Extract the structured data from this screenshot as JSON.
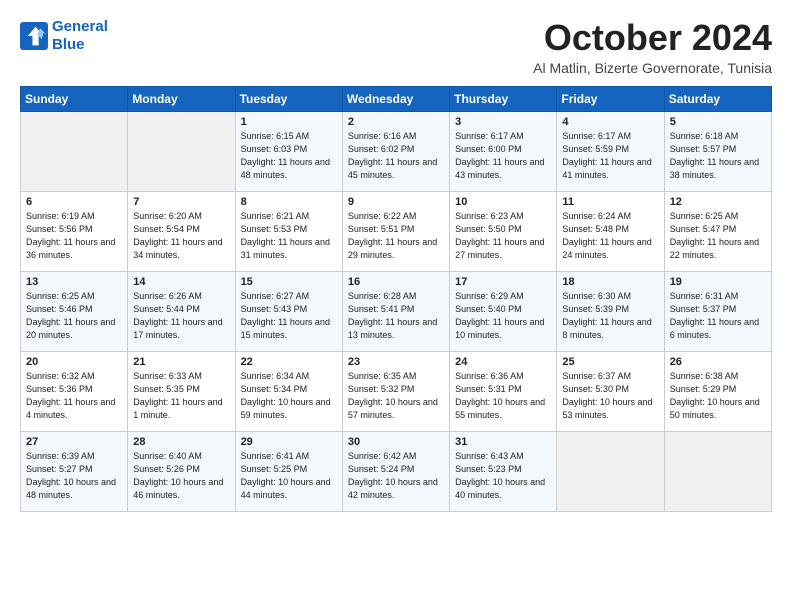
{
  "logo": {
    "line1": "General",
    "line2": "Blue"
  },
  "title": "October 2024",
  "location": "Al Matlin, Bizerte Governorate, Tunisia",
  "weekdays": [
    "Sunday",
    "Monday",
    "Tuesday",
    "Wednesday",
    "Thursday",
    "Friday",
    "Saturday"
  ],
  "weeks": [
    [
      {
        "day": "",
        "info": ""
      },
      {
        "day": "",
        "info": ""
      },
      {
        "day": "1",
        "info": "Sunrise: 6:15 AM\nSunset: 6:03 PM\nDaylight: 11 hours and 48 minutes."
      },
      {
        "day": "2",
        "info": "Sunrise: 6:16 AM\nSunset: 6:02 PM\nDaylight: 11 hours and 45 minutes."
      },
      {
        "day": "3",
        "info": "Sunrise: 6:17 AM\nSunset: 6:00 PM\nDaylight: 11 hours and 43 minutes."
      },
      {
        "day": "4",
        "info": "Sunrise: 6:17 AM\nSunset: 5:59 PM\nDaylight: 11 hours and 41 minutes."
      },
      {
        "day": "5",
        "info": "Sunrise: 6:18 AM\nSunset: 5:57 PM\nDaylight: 11 hours and 38 minutes."
      }
    ],
    [
      {
        "day": "6",
        "info": "Sunrise: 6:19 AM\nSunset: 5:56 PM\nDaylight: 11 hours and 36 minutes."
      },
      {
        "day": "7",
        "info": "Sunrise: 6:20 AM\nSunset: 5:54 PM\nDaylight: 11 hours and 34 minutes."
      },
      {
        "day": "8",
        "info": "Sunrise: 6:21 AM\nSunset: 5:53 PM\nDaylight: 11 hours and 31 minutes."
      },
      {
        "day": "9",
        "info": "Sunrise: 6:22 AM\nSunset: 5:51 PM\nDaylight: 11 hours and 29 minutes."
      },
      {
        "day": "10",
        "info": "Sunrise: 6:23 AM\nSunset: 5:50 PM\nDaylight: 11 hours and 27 minutes."
      },
      {
        "day": "11",
        "info": "Sunrise: 6:24 AM\nSunset: 5:48 PM\nDaylight: 11 hours and 24 minutes."
      },
      {
        "day": "12",
        "info": "Sunrise: 6:25 AM\nSunset: 5:47 PM\nDaylight: 11 hours and 22 minutes."
      }
    ],
    [
      {
        "day": "13",
        "info": "Sunrise: 6:25 AM\nSunset: 5:46 PM\nDaylight: 11 hours and 20 minutes."
      },
      {
        "day": "14",
        "info": "Sunrise: 6:26 AM\nSunset: 5:44 PM\nDaylight: 11 hours and 17 minutes."
      },
      {
        "day": "15",
        "info": "Sunrise: 6:27 AM\nSunset: 5:43 PM\nDaylight: 11 hours and 15 minutes."
      },
      {
        "day": "16",
        "info": "Sunrise: 6:28 AM\nSunset: 5:41 PM\nDaylight: 11 hours and 13 minutes."
      },
      {
        "day": "17",
        "info": "Sunrise: 6:29 AM\nSunset: 5:40 PM\nDaylight: 11 hours and 10 minutes."
      },
      {
        "day": "18",
        "info": "Sunrise: 6:30 AM\nSunset: 5:39 PM\nDaylight: 11 hours and 8 minutes."
      },
      {
        "day": "19",
        "info": "Sunrise: 6:31 AM\nSunset: 5:37 PM\nDaylight: 11 hours and 6 minutes."
      }
    ],
    [
      {
        "day": "20",
        "info": "Sunrise: 6:32 AM\nSunset: 5:36 PM\nDaylight: 11 hours and 4 minutes."
      },
      {
        "day": "21",
        "info": "Sunrise: 6:33 AM\nSunset: 5:35 PM\nDaylight: 11 hours and 1 minute."
      },
      {
        "day": "22",
        "info": "Sunrise: 6:34 AM\nSunset: 5:34 PM\nDaylight: 10 hours and 59 minutes."
      },
      {
        "day": "23",
        "info": "Sunrise: 6:35 AM\nSunset: 5:32 PM\nDaylight: 10 hours and 57 minutes."
      },
      {
        "day": "24",
        "info": "Sunrise: 6:36 AM\nSunset: 5:31 PM\nDaylight: 10 hours and 55 minutes."
      },
      {
        "day": "25",
        "info": "Sunrise: 6:37 AM\nSunset: 5:30 PM\nDaylight: 10 hours and 53 minutes."
      },
      {
        "day": "26",
        "info": "Sunrise: 6:38 AM\nSunset: 5:29 PM\nDaylight: 10 hours and 50 minutes."
      }
    ],
    [
      {
        "day": "27",
        "info": "Sunrise: 6:39 AM\nSunset: 5:27 PM\nDaylight: 10 hours and 48 minutes."
      },
      {
        "day": "28",
        "info": "Sunrise: 6:40 AM\nSunset: 5:26 PM\nDaylight: 10 hours and 46 minutes."
      },
      {
        "day": "29",
        "info": "Sunrise: 6:41 AM\nSunset: 5:25 PM\nDaylight: 10 hours and 44 minutes."
      },
      {
        "day": "30",
        "info": "Sunrise: 6:42 AM\nSunset: 5:24 PM\nDaylight: 10 hours and 42 minutes."
      },
      {
        "day": "31",
        "info": "Sunrise: 6:43 AM\nSunset: 5:23 PM\nDaylight: 10 hours and 40 minutes."
      },
      {
        "day": "",
        "info": ""
      },
      {
        "day": "",
        "info": ""
      }
    ]
  ]
}
